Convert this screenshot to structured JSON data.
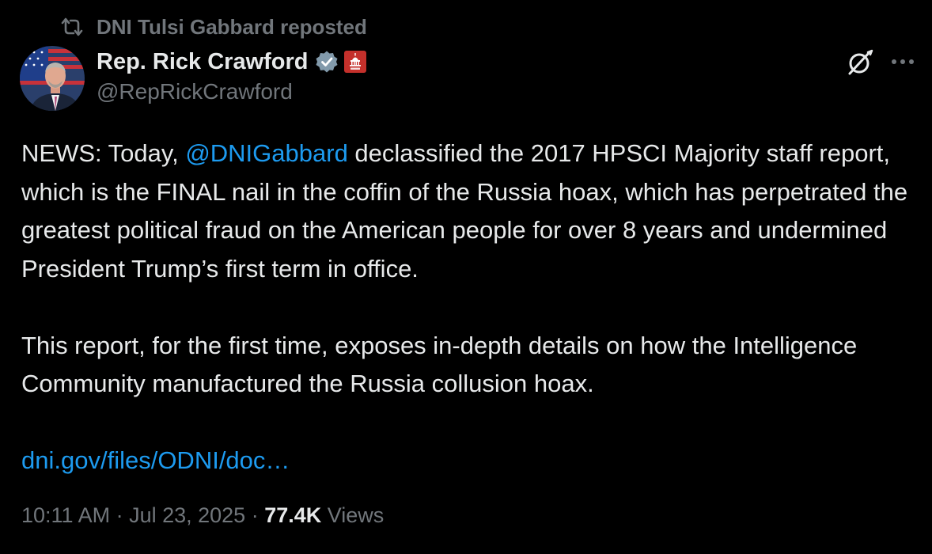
{
  "repost": {
    "label": "DNI Tulsi Gabbard reposted",
    "icon": "repost-icon"
  },
  "author": {
    "display_name": "Rep. Rick Crawford",
    "handle": "@RepRickCrawford",
    "verified_icon": "verified-gray-badge-icon",
    "affiliation_icon": "us-capitol-badge-icon"
  },
  "tweet": {
    "para1_before_mention": "NEWS: Today, ",
    "mention": "@DNIGabbard",
    "para1_after_mention": " declassified the 2017 HPSCI Majority staff report, which is the FINAL nail in the coffin of the Russia hoax, which has perpetrated the greatest political fraud on the American people for over 8 years and undermined President Trump’s first term in office.",
    "para2": "This report, for the first time, exposes in-depth details on how the Intelligence Community manufactured the Russia collusion hoax.",
    "link": "dni.gov/files/ODNI/doc…"
  },
  "meta": {
    "time": "10:11 AM",
    "separator": " · ",
    "date": "Jul 23, 2025",
    "views_count": "77.4K",
    "views_label": " Views"
  },
  "colors": {
    "background": "#000000",
    "text": "#e7e9ea",
    "secondary": "#71767b",
    "accent": "#1d9bf0",
    "gov_badge": "#c4302b"
  }
}
